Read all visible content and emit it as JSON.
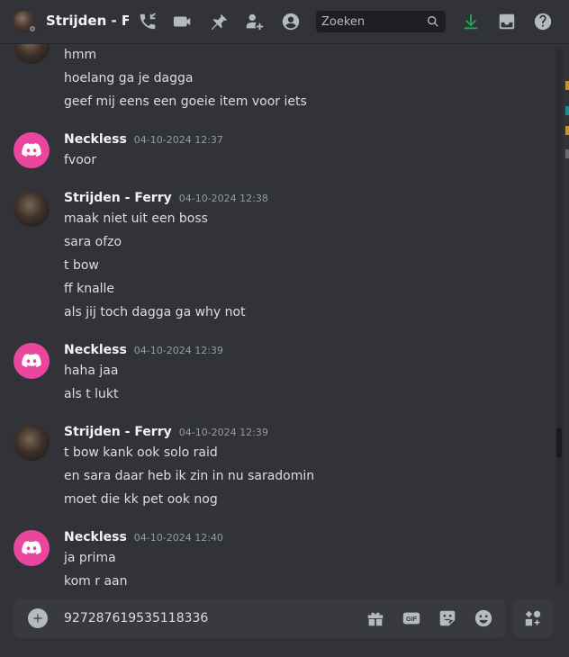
{
  "header": {
    "title": "Strijden - Ferry",
    "search_placeholder": "Zoeken"
  },
  "icons": {
    "call": "phone-call-icon",
    "video": "video-icon",
    "pin": "pin-icon",
    "add_member": "add-member-icon",
    "profile": "user-profile-icon",
    "search": "search-icon",
    "download": "download-icon",
    "inbox": "inbox-icon",
    "help": "help-icon"
  },
  "colors": {
    "background": "#313338",
    "bot_avatar": "#eb459e",
    "download_accent": "#23a55a",
    "text": "#dbdee1"
  },
  "messages": {
    "continuation": {
      "lines": [
        "hmm",
        "hoelang ga je dagga",
        "geef mij eens een goeie item voor iets"
      ]
    },
    "groups": [
      {
        "user": "Neckless",
        "time": "04-10-2024 12:37",
        "lines": [
          "fvoor"
        ]
      },
      {
        "user": "Strijden - Ferry",
        "time": "04-10-2024 12:38",
        "lines": [
          "maak niet uit een boss",
          "sara ofzo",
          "t bow",
          "ff knalle",
          "als jij toch dagga ga why not"
        ]
      },
      {
        "user": "Neckless",
        "time": "04-10-2024 12:39",
        "lines": [
          "haha jaa",
          "als t lukt"
        ]
      },
      {
        "user": "Strijden - Ferry",
        "time": "04-10-2024 12:39",
        "lines": [
          "t bow kank ook solo raid",
          "en sara daar heb ik zin in nu saradomin",
          "moet die kk pet ook nog"
        ]
      },
      {
        "user": "Neckless",
        "time": "04-10-2024 12:40",
        "lines": [
          "ja prima",
          "kom r aan"
        ]
      }
    ]
  },
  "composer": {
    "value": "927287619535118336",
    "gif_label": "GIF"
  }
}
